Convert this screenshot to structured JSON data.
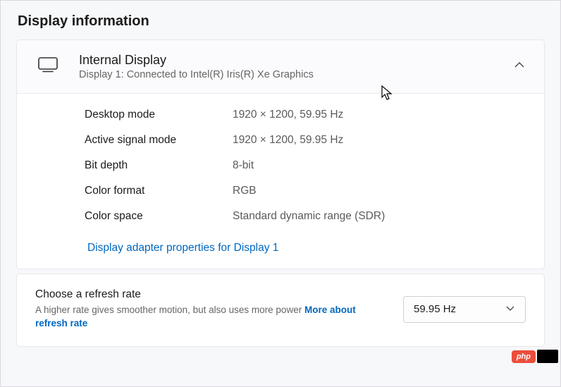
{
  "section_title": "Display information",
  "display": {
    "title": "Internal Display",
    "subtitle": "Display 1: Connected to Intel(R) Iris(R) Xe Graphics"
  },
  "properties": [
    {
      "label": "Desktop mode",
      "value": "1920 × 1200, 59.95 Hz"
    },
    {
      "label": "Active signal mode",
      "value": "1920 × 1200, 59.95 Hz"
    },
    {
      "label": "Bit depth",
      "value": "8-bit"
    },
    {
      "label": "Color format",
      "value": "RGB"
    },
    {
      "label": "Color space",
      "value": "Standard dynamic range (SDR)"
    }
  ],
  "adapter_link": "Display adapter properties for Display 1",
  "refresh": {
    "title": "Choose a refresh rate",
    "description_prefix": "A higher rate gives smoother motion, but also uses more power  ",
    "more_link": "More about refresh rate",
    "selected": "59.95 Hz"
  },
  "watermark": "php"
}
